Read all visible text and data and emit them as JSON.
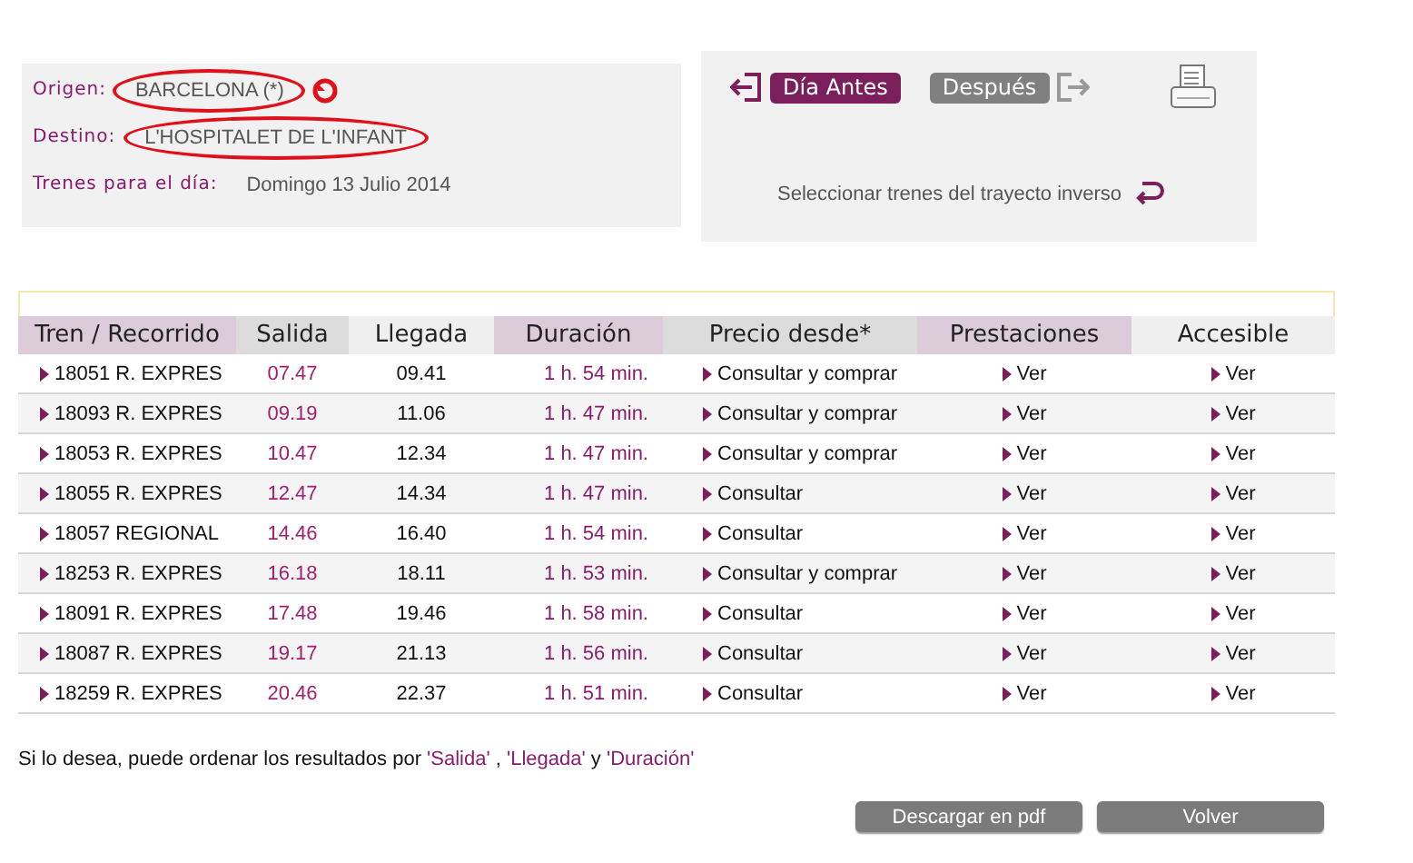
{
  "search": {
    "origin": {
      "label": "Origen:",
      "value": "BARCELONA (*)",
      "circled": true
    },
    "destination": {
      "label": "Destino:",
      "value": "L'HOSPITALET DE L'INFANT",
      "circled": true
    },
    "date": {
      "label": "Trenes para el día:",
      "value": "Domingo  13  Julio  2014"
    }
  },
  "day_nav": [
    {
      "label": "Día Antes",
      "kind": "previous"
    },
    {
      "label": "Después",
      "kind": "next"
    }
  ],
  "reverse_link": "Seleccionar trenes del trayecto inverso",
  "table": {
    "columns": [
      {
        "label": "Tren / Recorrido",
        "color": "#dccbd9"
      },
      {
        "label": "Salida",
        "color": "#dcdcdc"
      },
      {
        "label": "Llegada",
        "color": "#efefef"
      },
      {
        "label": "Duración",
        "color": "#dccbd9"
      },
      {
        "label": "Precio desde*",
        "color": "#dcdcdc"
      },
      {
        "label": "Prestaciones",
        "color": "#dccbd9"
      },
      {
        "label": "Accesible",
        "color": "#efefef"
      }
    ],
    "rows": [
      {
        "train": "18051 R. EXPRES",
        "departure": "07.47",
        "arrival": "09.41",
        "duration": "1 h. 54 min.",
        "price": "Consultar y comprar",
        "services": "Ver",
        "accessible": "Ver"
      },
      {
        "train": "18093 R. EXPRES",
        "departure": "09.19",
        "arrival": "11.06",
        "duration": "1 h. 47 min.",
        "price": "Consultar y comprar",
        "services": "Ver",
        "accessible": "Ver"
      },
      {
        "train": "18053 R. EXPRES",
        "departure": "10.47",
        "arrival": "12.34",
        "duration": "1 h. 47 min.",
        "price": "Consultar y comprar",
        "services": "Ver",
        "accessible": "Ver"
      },
      {
        "train": "18055 R. EXPRES",
        "departure": "12.47",
        "arrival": "14.34",
        "duration": "1 h. 47 min.",
        "price": "Consultar",
        "services": "Ver",
        "accessible": "Ver"
      },
      {
        "train": "18057 REGIONAL",
        "departure": "14.46",
        "arrival": "16.40",
        "duration": "1 h. 54 min.",
        "price": "Consultar",
        "services": "Ver",
        "accessible": "Ver"
      },
      {
        "train": "18253 R. EXPRES",
        "departure": "16.18",
        "arrival": "18.11",
        "duration": "1 h. 53 min.",
        "price": "Consultar y comprar",
        "services": "Ver",
        "accessible": "Ver"
      },
      {
        "train": "18091 R. EXPRES",
        "departure": "17.48",
        "arrival": "19.46",
        "duration": "1 h. 58 min.",
        "price": "Consultar",
        "services": "Ver",
        "accessible": "Ver"
      },
      {
        "train": "18087 R. EXPRES",
        "departure": "19.17",
        "arrival": "21.13",
        "duration": "1 h. 56 min.",
        "price": "Consultar",
        "services": "Ver",
        "accessible": "Ver"
      },
      {
        "train": "18259 R. EXPRES",
        "departure": "20.46",
        "arrival": "22.37",
        "duration": "1 h. 51 min.",
        "price": "Consultar",
        "services": "Ver",
        "accessible": "Ver"
      }
    ]
  },
  "sort_note": [
    {
      "kind": "text",
      "text": "Si lo desea, puede ordenar los resultados por "
    },
    {
      "kind": "link",
      "text": "'Salida'"
    },
    {
      "kind": "text",
      "text": " , "
    },
    {
      "kind": "link",
      "text": "'Llegada'"
    },
    {
      "kind": "text",
      "text": " y "
    },
    {
      "kind": "link",
      "text": "'Duración'"
    }
  ],
  "buttons": [
    "Descargar en pdf",
    "Volver"
  ]
}
